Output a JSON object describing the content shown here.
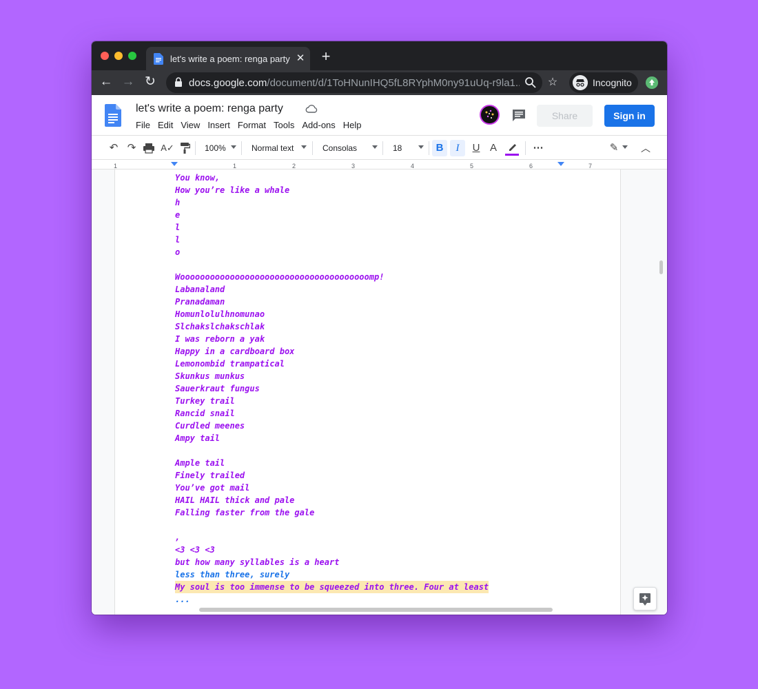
{
  "browser": {
    "tab_title": "let's write a poem: renga party",
    "tab_close": "✕",
    "new_tab": "+",
    "url_host": "docs.google.com",
    "url_path": "/document/d/1ToHNunIHQ5fL8RYphM0ny91uUq-r9la1...",
    "incognito_label": "Incognito"
  },
  "docs": {
    "title": "let's write a poem: renga party",
    "menu": [
      "File",
      "Edit",
      "View",
      "Insert",
      "Format",
      "Tools",
      "Add-ons",
      "Help"
    ],
    "share_label": "Share",
    "signin_label": "Sign in"
  },
  "toolbar": {
    "zoom": "100%",
    "style": "Normal text",
    "font": "Consolas",
    "size": "18",
    "bold": "B",
    "italic": "I",
    "underline": "U",
    "text_color": "A"
  },
  "ruler": {
    "numbers": [
      "1",
      "1",
      "2",
      "3",
      "4",
      "5",
      "6",
      "7"
    ]
  },
  "document": {
    "lines": [
      {
        "text": "You know,",
        "style": "purple"
      },
      {
        "text": "How you’re like a whale",
        "style": "purple"
      },
      {
        "text": "h",
        "style": "purple"
      },
      {
        "text": "e",
        "style": "purple"
      },
      {
        "text": "l",
        "style": "purple"
      },
      {
        "text": "l",
        "style": "purple"
      },
      {
        "text": "o",
        "style": "purple"
      },
      {
        "text": "",
        "style": "purple"
      },
      {
        "text": "Woooooooooooooooooooooooooooooooooooooomp!",
        "style": "purple"
      },
      {
        "text": "Labanaland",
        "style": "purple"
      },
      {
        "text": "Pranadaman",
        "style": "purple"
      },
      {
        "text": "Homunlolulhnomunao",
        "style": "purple"
      },
      {
        "text": "Slchakslchakschlak",
        "style": "purple"
      },
      {
        "text": "I was reborn a yak",
        "style": "purple"
      },
      {
        "text": "Happy in a cardboard box",
        "style": "purple"
      },
      {
        "text": "Lemonombid trampatical",
        "style": "purple"
      },
      {
        "text": "Skunkus munkus",
        "style": "purple"
      },
      {
        "text": "Sauerkraut fungus",
        "style": "purple"
      },
      {
        "text": "Turkey trail",
        "style": "purple"
      },
      {
        "text": "Rancid snail",
        "style": "purple"
      },
      {
        "text": "Curdled meenes",
        "style": "purple"
      },
      {
        "text": "Ampy tail",
        "style": "purple"
      },
      {
        "text": "",
        "style": "purple"
      },
      {
        "text": "Ample tail",
        "style": "purple"
      },
      {
        "text": "Finely trailed",
        "style": "purple"
      },
      {
        "text": "You’ve got mail",
        "style": "purple"
      },
      {
        "text": "HAIL HAIL thick and pale",
        "style": "purple"
      },
      {
        "text": "Falling faster from the gale",
        "style": "purple"
      },
      {
        "text": "",
        "style": "purple"
      },
      {
        "text": ",",
        "style": "purple"
      },
      {
        "text": "<3 <3 <3",
        "style": "purple"
      },
      {
        "text": "but how many syllables is a heart",
        "style": "purple"
      },
      {
        "text": "less than three, surely",
        "style": "blue"
      },
      {
        "text": "My soul is too immense to be squeezed into three. Four at least",
        "style": "highlight"
      },
      {
        "text": "...",
        "style": "blue"
      }
    ]
  },
  "colors": {
    "background": "#b266ff",
    "text_purple": "#9b10ef",
    "text_blue": "#1a73e8",
    "highlight": "#fce8b2",
    "signin": "#1a73e8"
  }
}
